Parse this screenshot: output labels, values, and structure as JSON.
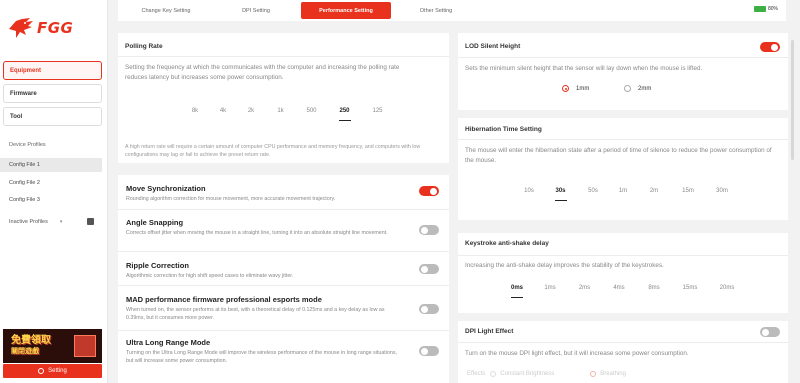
{
  "brand": {
    "name": "FGG",
    "accent": "#e8321e"
  },
  "nav": [
    {
      "label": "Equipment",
      "active": true
    },
    {
      "label": "Firmware",
      "active": false
    },
    {
      "label": "Tool",
      "active": false
    }
  ],
  "profiles": {
    "title": "Device Profiles",
    "items": [
      "Config File 1",
      "Config File 2",
      "Config File 3"
    ],
    "inactive_label": "Inactive Profiles"
  },
  "promo": {
    "line1": "免費領取",
    "line2": "關閉遊戲"
  },
  "setting_label": "Setting",
  "tabs": [
    {
      "label": "Change Key Setting"
    },
    {
      "label": "DPI Setting"
    },
    {
      "label": "Performance Setting",
      "active": true
    },
    {
      "label": "Other Setting"
    }
  ],
  "battery": {
    "percent": "80%"
  },
  "polling": {
    "title": "Polling Rate",
    "desc": "Setting the frequency at which the communicates with the computer and increasing the polling rate reduces latency but increases some power consumption.",
    "rates": [
      "8k",
      "4k",
      "2k",
      "1k",
      "500",
      "250",
      "125"
    ],
    "selected": "250",
    "note": "A high return rate will require a certain amount of computer CPU performance and memory frequency, and computers with low configurations may lag or fail to achieve the preset return rate."
  },
  "switches": [
    {
      "title": "Move Synchronization",
      "desc": "Rounding algorithm correction for mouse movement, more accurate movement trajectory.",
      "on": true
    },
    {
      "title": "Angle Snapping",
      "desc": "Corrects offset jitter when moving the mouse in a straight line, turning it into an absolute straight line movement.",
      "on": false
    },
    {
      "title": "Ripple Correction",
      "desc": "Algorithmic correction for high shift speed cases to eliminate wavy jitter.",
      "on": false
    },
    {
      "title": "MAD performance firmware professional esports mode",
      "desc": "When turned on, the sensor performs at its best, with a theoretical delay of 0.125ms and a key delay as low as 0.39ms, but it consumes more power.",
      "on": false
    },
    {
      "title": "Ultra Long Range Mode",
      "desc": "Turning on the Ultra Long Range Mode will improve the wireless performance of the mouse in long range situations, but will increase some power consumption.",
      "on": false
    }
  ],
  "lod": {
    "title": "LOD Silent Height",
    "desc": "Sets the minimum silent height that the sensor will lay down when the mouse is lifted.",
    "options": [
      "1mm",
      "2mm"
    ],
    "selected": "1mm",
    "on": true
  },
  "hibernation": {
    "title": "Hibernation Time Setting",
    "desc": "The mouse will enter the hibernation state after a period of time of silence to reduce the power consumption of the mouse.",
    "options": [
      "10s",
      "30s",
      "50s",
      "1m",
      "2m",
      "15m",
      "30m"
    ],
    "selected": "30s"
  },
  "keystroke": {
    "title": "Keystroke anti-shake delay",
    "desc": "Increasing the anti-shake delay improves the stability of the keystrokes.",
    "options": [
      "0ms",
      "1ms",
      "2ms",
      "4ms",
      "8ms",
      "15ms",
      "20ms"
    ],
    "selected": "0ms"
  },
  "dpi_light": {
    "title": "DPI Light Effect",
    "desc": "Turn on the mouse DPI light effect, but it will increase some power consumption.",
    "effects_label": "Effects",
    "effects": [
      "Constant Brightness",
      "Breathing"
    ],
    "on": false
  }
}
